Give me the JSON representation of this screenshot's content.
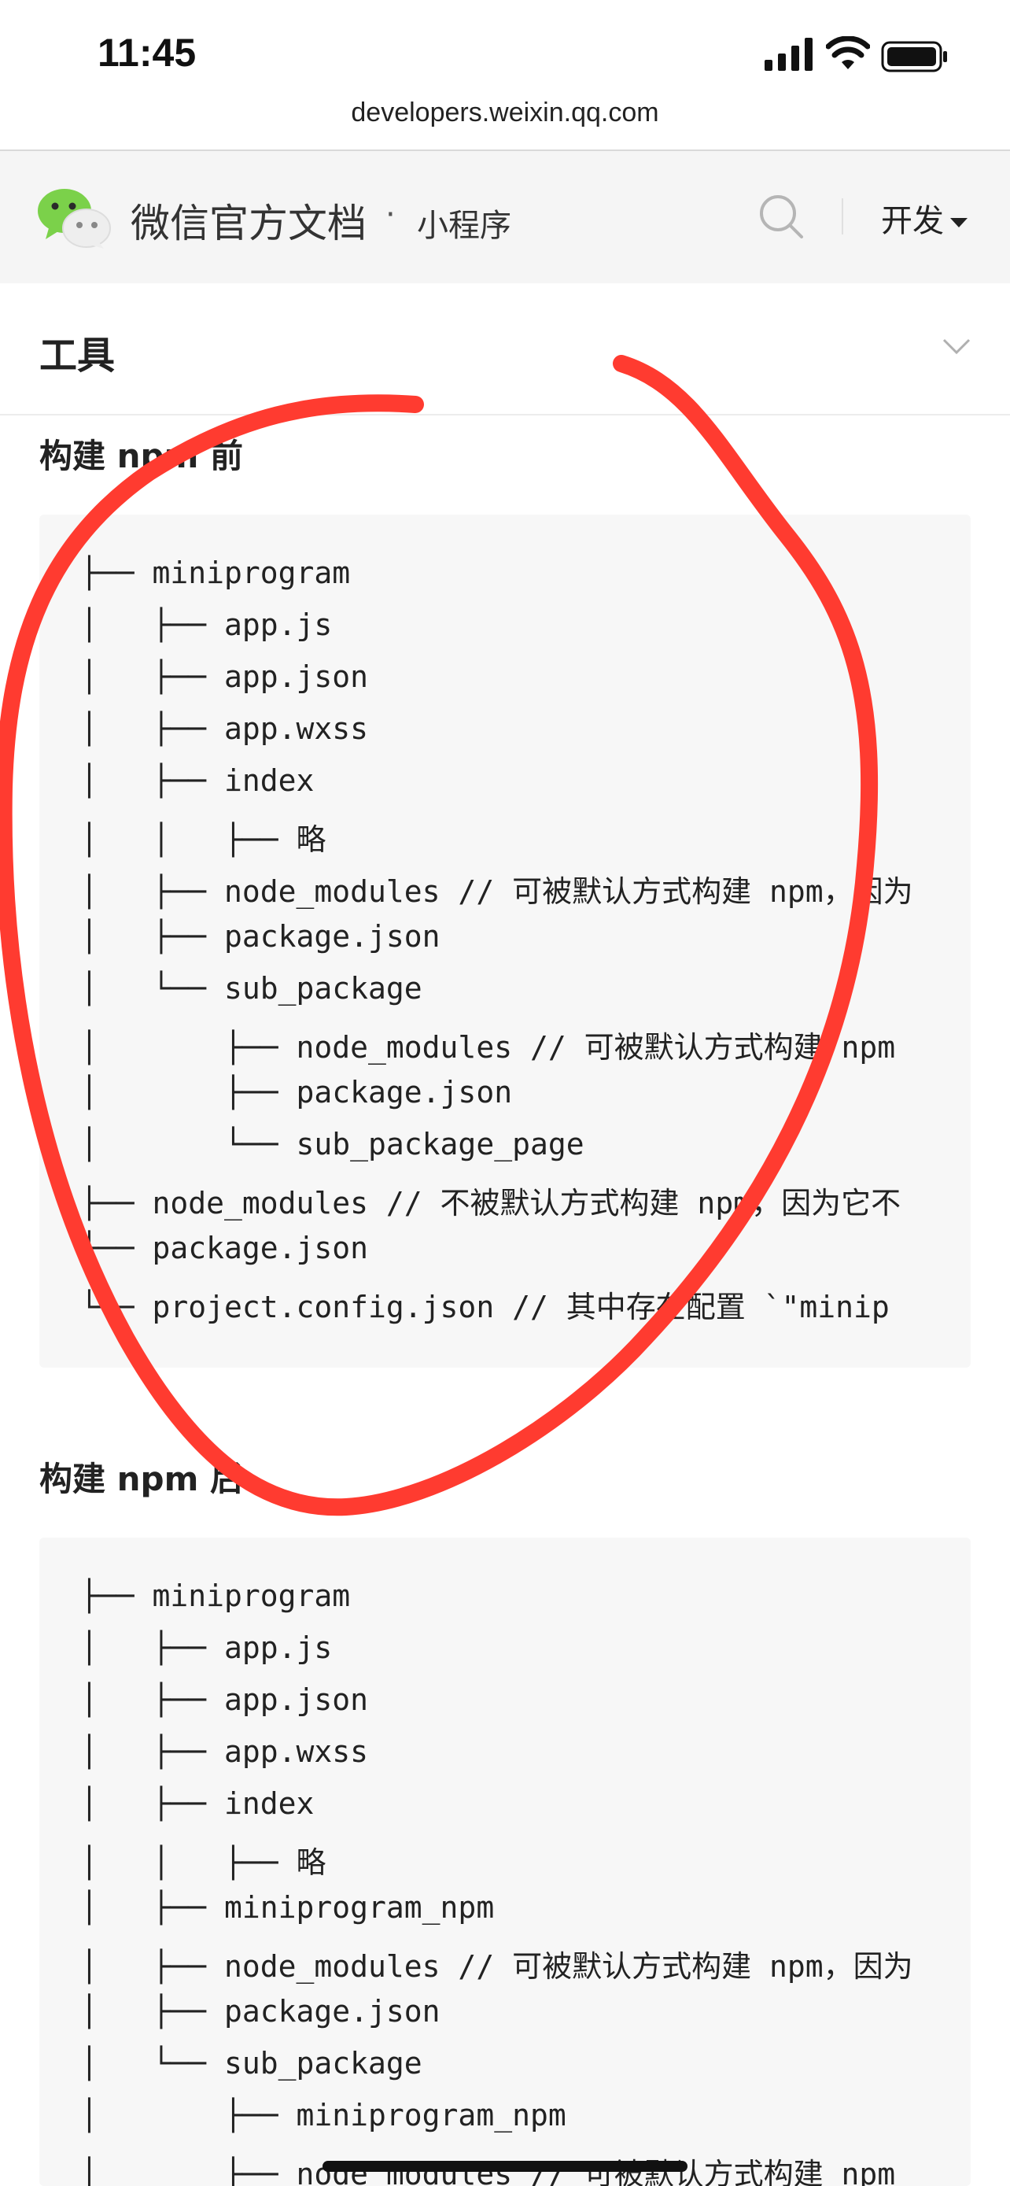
{
  "status_bar": {
    "time": "11:45"
  },
  "browser": {
    "url": "developers.weixin.qq.com"
  },
  "site": {
    "title": "微信官方文档",
    "separator": "·",
    "subtitle": "小程序",
    "menu_label": "开发",
    "icons": [
      "wechat-logo",
      "search-icon",
      "caret-down-icon"
    ]
  },
  "tools_nav": {
    "label": "工具",
    "icon": "chevron-down-icon"
  },
  "before": {
    "title": "构建 npm 前",
    "lines": [
      "├── miniprogram",
      "│   ├── app.js",
      "│   ├── app.json",
      "│   ├── app.wxss",
      "│   ├── index",
      "│   │   ├── 略",
      "│   ├── node_modules // 可被默认方式构建 npm，因为",
      "│   ├── package.json",
      "│   └── sub_package",
      "│       ├── node_modules // 可被默认方式构建 npm",
      "│       ├── package.json",
      "│       └── sub_package_page",
      "├── node_modules // 不被默认方式构建 npm，因为它不",
      "├── package.json",
      "└── project.config.json // 其中存在配置 `\"minip"
    ]
  },
  "after": {
    "title": "构建 npm 后",
    "lines": [
      "├── miniprogram",
      "│   ├── app.js",
      "│   ├── app.json",
      "│   ├── app.wxss",
      "│   ├── index",
      "│   │   ├── 略",
      "│   ├── miniprogram_npm",
      "│   ├── node_modules // 可被默认方式构建 npm，因为",
      "│   ├── package.json",
      "│   └── sub_package",
      "│       ├── miniprogram_npm",
      "│       ├── node_modules // 可被默认方式构建 npm"
    ]
  },
  "colors": {
    "annotation": "#ff3b30",
    "header_bg": "#f5f5f5",
    "code_bg": "#f7f7f7"
  }
}
